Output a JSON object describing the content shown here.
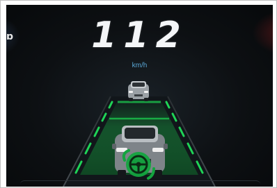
{
  "cluster": {
    "speed": "112",
    "speed_unit": "km/h",
    "left_glyph": "ɒ"
  },
  "colors": {
    "background": "#0d1013",
    "lane_green": "#1bbf4b",
    "speed_text": "#f4f6f8",
    "unit_text": "#5aa7d6"
  },
  "icons": {
    "lead_vehicle": "lead-car-icon",
    "ego_vehicle": "ego-car-icon",
    "steering_assist": "steering-wheel-icon"
  }
}
